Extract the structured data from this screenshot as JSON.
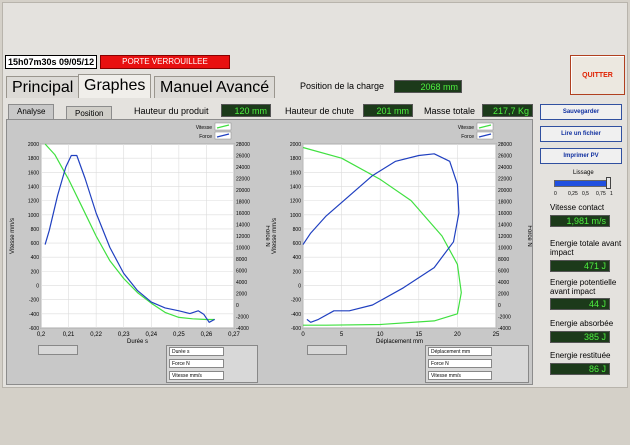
{
  "header": {
    "datetime": "15h07m30s 09/05/12",
    "status": "PORTE VERROUILLEE",
    "quit_label": "QUITTER"
  },
  "tabs": {
    "principal": "Principal",
    "graphes": "Graphes",
    "manuel": "Manuel Avancé"
  },
  "charge": {
    "label": "Position de la charge",
    "value": "2068 mm"
  },
  "subtabs": {
    "analyse": "Analyse",
    "position": "Position"
  },
  "hauteur_produit": {
    "label": "Hauteur du produit",
    "value": "120 mm"
  },
  "hauteur_chute": {
    "label": "Hauteur de chute",
    "value": "201 mm"
  },
  "masse": {
    "label": "Masse totale",
    "value": "217,7 Kg"
  },
  "side": {
    "save": "Sauvegarder",
    "read": "Lire un fichier",
    "print": "Imprimer PV",
    "lissage_label": "Lissage",
    "lissage_ticks": [
      "0",
      "0,25",
      "0,5",
      "0,75",
      "1"
    ],
    "lissage_value": 1,
    "vitesse_label": "Vitesse contact",
    "vitesse_value": "1,981 m/s",
    "et_label": "Energie totale avant impact",
    "et_value": "471 J",
    "ep_label": "Energie potentielle avant impact",
    "ep_value": "44 J",
    "ea_label": "Energie absorbée",
    "ea_value": "385 J",
    "er_label": "Energie restituée",
    "er_value": "86 J"
  },
  "chart1_controls": {
    "c1": "Durée s",
    "c2": "Force N",
    "c3": "Vitesse mm/s"
  },
  "chart2_controls": {
    "c1": "Déplacement mm",
    "c2": "Force N",
    "c3": "Vitesse mm/s"
  },
  "colors": {
    "vitesse": "#40e040",
    "force": "#2040c0"
  },
  "chart_data": [
    {
      "type": "line",
      "xlabel": "Durée s",
      "ylabel": "Vitesse mm/s",
      "y2label": "Force N",
      "legend": [
        "Vitesse",
        "Force"
      ],
      "xlim": [
        0.2,
        0.27
      ],
      "xticks": [
        "0,2",
        "0,21",
        "0,22",
        "0,23",
        "0,24",
        "0,25",
        "0,26",
        "0,27"
      ],
      "ylim": [
        -600,
        2000
      ],
      "yticks": [
        "2000",
        "1800",
        "1600",
        "1400",
        "1200",
        "1000",
        "800",
        "600",
        "400",
        "200",
        "0",
        "-200",
        "-400",
        "-600"
      ],
      "y2lim": [
        -4000,
        28000
      ],
      "y2ticks": [
        "28000",
        "26000",
        "24000",
        "22000",
        "20000",
        "18000",
        "16000",
        "14000",
        "12000",
        "10000",
        "8000",
        "6000",
        "4000",
        "2000",
        "0",
        "-2000",
        "-4000"
      ],
      "series": [
        {
          "name": "Vitesse",
          "axis": "left",
          "points": [
            [
              0.2015,
              2000
            ],
            [
              0.205,
              1850
            ],
            [
              0.21,
              1500
            ],
            [
              0.215,
              1100
            ],
            [
              0.22,
              700
            ],
            [
              0.225,
              350
            ],
            [
              0.23,
              100
            ],
            [
              0.235,
              -100
            ],
            [
              0.24,
              -250
            ],
            [
              0.245,
              -380
            ],
            [
              0.25,
              -450
            ],
            [
              0.255,
              -470
            ],
            [
              0.26,
              -480
            ],
            [
              0.263,
              -480
            ]
          ]
        },
        {
          "name": "Force",
          "axis": "right",
          "points": [
            [
              0.2015,
              10500
            ],
            [
              0.203,
              13000
            ],
            [
              0.206,
              19000
            ],
            [
              0.209,
              24000
            ],
            [
              0.211,
              26000
            ],
            [
              0.213,
              26000
            ],
            [
              0.216,
              22000
            ],
            [
              0.22,
              16000
            ],
            [
              0.225,
              10000
            ],
            [
              0.23,
              5500
            ],
            [
              0.235,
              2500
            ],
            [
              0.24,
              500
            ],
            [
              0.245,
              -500
            ],
            [
              0.25,
              -1000
            ],
            [
              0.254,
              -1500
            ],
            [
              0.257,
              -1000
            ],
            [
              0.259,
              -1600
            ],
            [
              0.261,
              -3000
            ],
            [
              0.263,
              -2500
            ]
          ]
        }
      ]
    },
    {
      "type": "line",
      "xlabel": "Déplacement mm",
      "ylabel": "Vitesse mm/s",
      "y2label": "Force N",
      "legend": [
        "Vitesse",
        "Force"
      ],
      "xlim": [
        0,
        25
      ],
      "xticks": [
        "0",
        "5",
        "10",
        "15",
        "20",
        "25"
      ],
      "ylim": [
        -600,
        2000
      ],
      "yticks": [
        "2000",
        "1800",
        "1600",
        "1400",
        "1200",
        "1000",
        "800",
        "600",
        "400",
        "200",
        "0",
        "-200",
        "-400",
        "-600"
      ],
      "y2lim": [
        -4000,
        28000
      ],
      "y2ticks": [
        "28000",
        "26000",
        "24000",
        "22000",
        "20000",
        "18000",
        "16000",
        "14000",
        "12000",
        "10000",
        "8000",
        "6000",
        "4000",
        "2000",
        "0",
        "-2000",
        "-4000"
      ],
      "series": [
        {
          "name": "Vitesse",
          "axis": "left",
          "points": [
            [
              0,
              1950
            ],
            [
              5,
              1800
            ],
            [
              10,
              1500
            ],
            [
              14,
              1200
            ],
            [
              18,
              700
            ],
            [
              20,
              300
            ],
            [
              20.5,
              -100
            ],
            [
              20,
              -400
            ],
            [
              17,
              -500
            ],
            [
              10,
              -550
            ],
            [
              3,
              -560
            ],
            [
              0,
              -560
            ]
          ]
        },
        {
          "name": "Force",
          "axis": "right",
          "points": [
            [
              0,
              10500
            ],
            [
              1,
              12500
            ],
            [
              3,
              15500
            ],
            [
              6,
              19000
            ],
            [
              9,
              22500
            ],
            [
              12,
              25000
            ],
            [
              15,
              26000
            ],
            [
              17,
              26300
            ],
            [
              19,
              25000
            ],
            [
              20,
              21000
            ],
            [
              20.2,
              16000
            ],
            [
              19.5,
              11000
            ],
            [
              17,
              6500
            ],
            [
              13,
              3000
            ],
            [
              9,
              0
            ],
            [
              6,
              -1000
            ],
            [
              4,
              -1000
            ],
            [
              2,
              -2500
            ],
            [
              1,
              -3000
            ],
            [
              0.5,
              -2500
            ]
          ]
        }
      ]
    }
  ]
}
